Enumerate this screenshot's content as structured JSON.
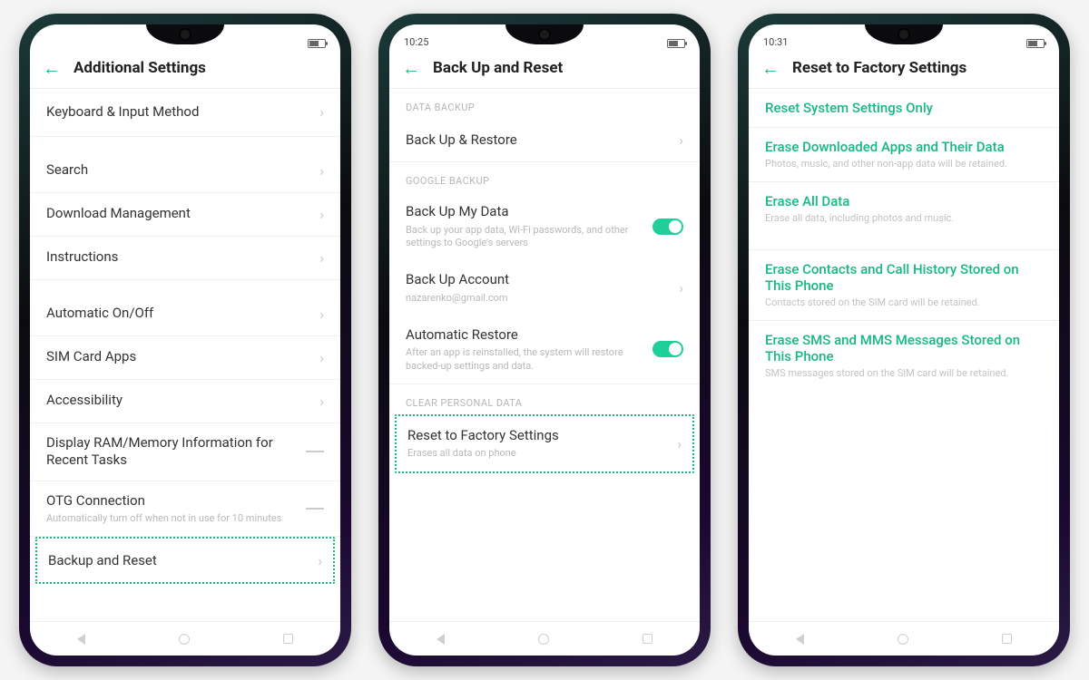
{
  "colors": {
    "accent": "#16b97f"
  },
  "phone1": {
    "status": {
      "time": "",
      "battery": true
    },
    "header": {
      "title": "Additional Settings"
    },
    "rows": {
      "keyboard": "Keyboard & Input Method",
      "search": "Search",
      "download": "Download Management",
      "instructions": "Instructions",
      "auto": "Automatic On/Off",
      "sim": "SIM Card Apps",
      "accessibility": "Accessibility",
      "ram": "Display RAM/Memory Information for Recent Tasks",
      "otg": "OTG Connection",
      "otg_sub": "Automatically turn off when not in use for 10 minutes",
      "backup": "Backup and Reset"
    }
  },
  "phone2": {
    "status": {
      "time": "10:25"
    },
    "header": {
      "title": "Back Up and Reset"
    },
    "sections": {
      "data_backup": "DATA BACKUP",
      "google_backup": "GOOGLE BACKUP",
      "clear": "CLEAR PERSONAL DATA"
    },
    "rows": {
      "backup_restore": "Back Up & Restore",
      "backup_my_data": "Back Up My Data",
      "backup_my_data_sub": "Back up your app data, Wi-Fi passwords, and other settings to Google's servers",
      "backup_account": "Back Up Account",
      "backup_account_sub": "nazarenko@gmail.com",
      "auto_restore": "Automatic Restore",
      "auto_restore_sub": "After an app is reinstalled, the system will restore backed-up settings and data.",
      "reset": "Reset to Factory Settings",
      "reset_sub": "Erases all data on phone"
    }
  },
  "phone3": {
    "status": {
      "time": "10:31"
    },
    "header": {
      "title": "Reset to Factory Settings"
    },
    "options": {
      "o1": "Reset System Settings Only",
      "o2": "Erase Downloaded Apps and Their Data",
      "o2_sub": "Photos, music, and other non-app data will be retained.",
      "o3": "Erase All Data",
      "o3_sub": "Erase all data, including photos and music.",
      "o4": "Erase Contacts and Call History Stored on This Phone",
      "o4_sub": "Contacts stored on the SIM card will be retained.",
      "o5": "Erase SMS and MMS Messages Stored on This Phone",
      "o5_sub": "SMS messages stored on the SIM card will be retained."
    }
  }
}
